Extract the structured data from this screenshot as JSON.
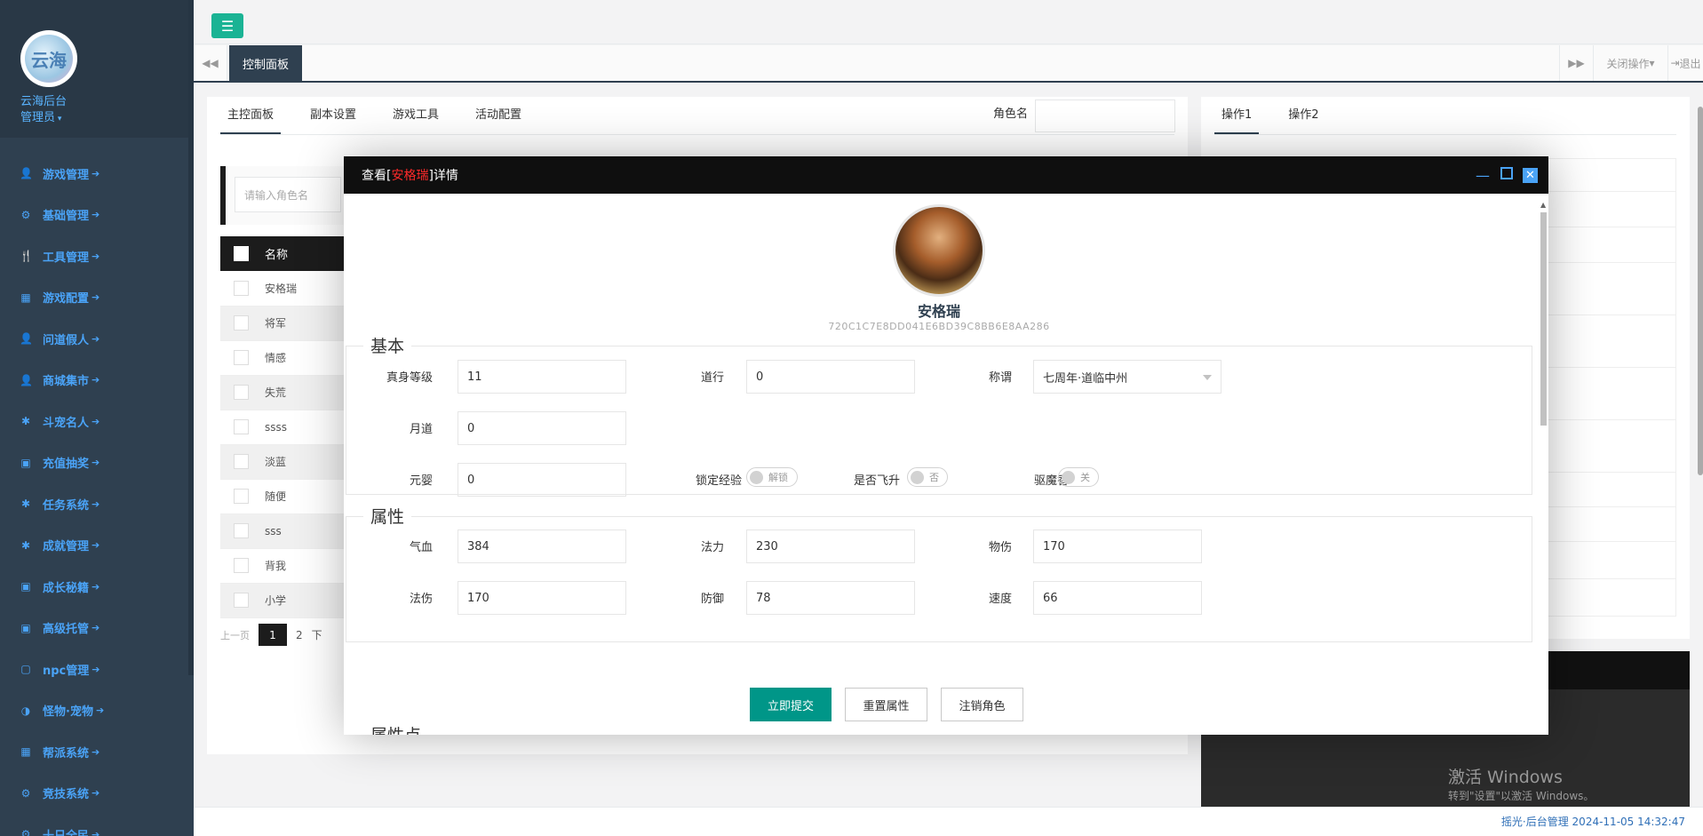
{
  "sidebar": {
    "site_name": "云海后台",
    "role": "管理员",
    "logo_text": "云海",
    "items": [
      {
        "icon": "user-icon",
        "glyph": "👤",
        "label": "游戏管理"
      },
      {
        "icon": "cogs-icon",
        "glyph": "⚙",
        "label": "基础管理"
      },
      {
        "icon": "cutlery-icon",
        "glyph": "🍴",
        "label": "工具管理"
      },
      {
        "icon": "table-icon",
        "glyph": "▦",
        "label": "游戏配置"
      },
      {
        "icon": "user-icon",
        "glyph": "👤",
        "label": "问道假人"
      },
      {
        "icon": "user-icon",
        "glyph": "👤",
        "label": "商城集市"
      },
      {
        "icon": "asterisk-icon",
        "glyph": "✱",
        "label": "斗宠名人"
      },
      {
        "icon": "money-icon",
        "glyph": "▣",
        "label": "充值抽奖"
      },
      {
        "icon": "asterisk-icon",
        "glyph": "✱",
        "label": "任务系统"
      },
      {
        "icon": "asterisk-icon",
        "glyph": "✱",
        "label": "成就管理"
      },
      {
        "icon": "money-icon",
        "glyph": "▣",
        "label": "成长秘籍"
      },
      {
        "icon": "money-icon",
        "glyph": "▣",
        "label": "高级托管"
      },
      {
        "icon": "square-icon",
        "glyph": "▢",
        "label": "npc管理"
      },
      {
        "icon": "adjust-icon",
        "glyph": "◑",
        "label": "怪物·宠物"
      },
      {
        "icon": "table-icon",
        "glyph": "▦",
        "label": "帮派系统"
      },
      {
        "icon": "cogs-icon",
        "glyph": "⚙",
        "label": "竞技系统"
      },
      {
        "icon": "cogs-icon",
        "glyph": "⚙",
        "label": "十日全民"
      }
    ]
  },
  "topbar": {
    "menu_icon": "☰"
  },
  "tabbar": {
    "back_icon": "◀◀",
    "active_tab": "控制面板",
    "forward_icon": "▶▶",
    "close_ops": "关闭操作",
    "logout": "退出"
  },
  "main": {
    "tabs": [
      "主控面板",
      "副本设置",
      "游戏工具",
      "活动配置"
    ],
    "role_label": "角色名",
    "role_input_value": "",
    "search_placeholder": "请输入角色名",
    "table": {
      "header": "名称",
      "rows": [
        "安格瑞",
        "将军",
        "情感",
        "失荒",
        "ssss",
        "淡蓝",
        "随便",
        "sss",
        "背我",
        "小学"
      ]
    },
    "pager": {
      "prev": "上一页",
      "pages": [
        "1",
        "2"
      ],
      "next": "下"
    }
  },
  "right": {
    "tabs": [
      "操作1",
      "操作2"
    ]
  },
  "watermark": {
    "title": "激活 Windows",
    "subtitle": "转到\"设置\"以激活 Windows。"
  },
  "footer": {
    "text": "摇光·后台管理 2024-11-05 14:32:47"
  },
  "modal": {
    "title_prefix": "查看[",
    "title_name": "安格瑞",
    "title_suffix": "]详情",
    "char_name": "安格瑞",
    "char_id": "720C1C7E8DD041E6BD39C8BB6E8AA286",
    "section_basic": "基本",
    "section_attr": "属性",
    "section_points": "属性点",
    "basic": {
      "true_level_label": "真身等级",
      "true_level": "11",
      "daohang_label": "道行",
      "daohang": "0",
      "title_label": "称谓",
      "title_value": "七周年·道临中州",
      "yuedao_label": "月道",
      "yuedao": "0",
      "yuanying_label": "元婴",
      "yuanying": "0",
      "lock_exp_label": "锁定经验",
      "lock_exp": "解锁",
      "fly_label": "是否飞升",
      "fly": "否",
      "incense_label": "驱魔香",
      "incense": "关"
    },
    "attr": {
      "hp_label": "气血",
      "hp": "384",
      "mp_label": "法力",
      "mp": "230",
      "phy_label": "物伤",
      "phy": "170",
      "mag_label": "法伤",
      "mag": "170",
      "def_label": "防御",
      "def": "78",
      "speed_label": "速度",
      "speed": "66"
    },
    "buttons": {
      "submit": "立即提交",
      "reset": "重置属性",
      "cancel": "注销角色"
    }
  }
}
